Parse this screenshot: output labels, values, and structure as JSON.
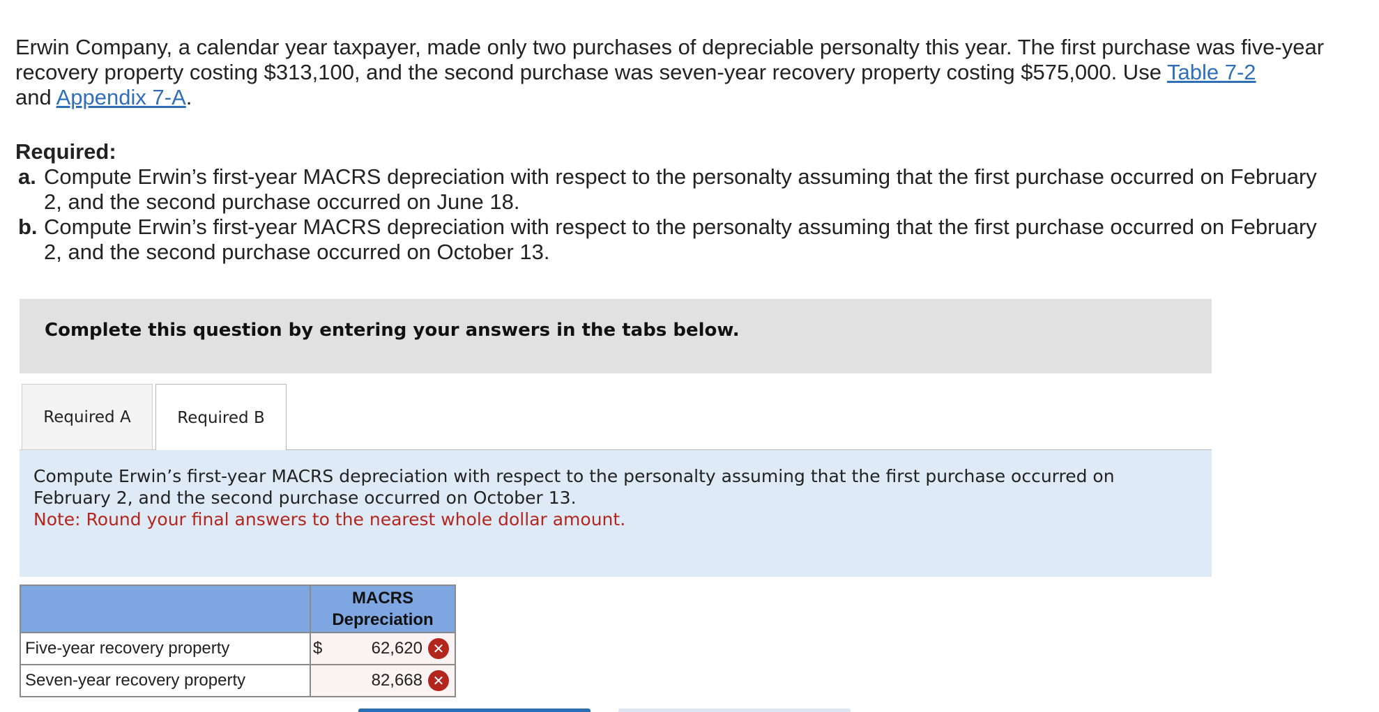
{
  "problem": {
    "intro_text": "Erwin Company, a calendar year taxpayer, made only two purchases of depreciable personalty this year. The first purchase was five-year recovery property costing $313,100, and the second purchase was seven-year recovery property costing $575,000. Use ",
    "link_table": "Table 7-2",
    "joiner": "and ",
    "link_appendix": "Appendix 7-A",
    "end_period": ".",
    "required_heading": "Required:",
    "items": [
      {
        "letter": "a.",
        "text": "Compute Erwin’s first-year MACRS depreciation with respect to the personalty assuming that the first purchase occurred on February 2, and the second purchase occurred on June 18."
      },
      {
        "letter": "b.",
        "text": "Compute Erwin’s first-year MACRS depreciation with respect to the personalty assuming that the first purchase occurred on February 2, and the second purchase occurred on October 13."
      }
    ]
  },
  "banner": {
    "text": "Complete this question by entering your answers in the tabs below."
  },
  "tabs": [
    {
      "label": "Required A",
      "active": false
    },
    {
      "label": "Required B",
      "active": true
    }
  ],
  "instructions": {
    "text": "Compute Erwin’s first-year MACRS depreciation with respect to the personalty assuming that the first purchase occurred on February 2, and the second purchase occurred on October 13.",
    "note": "Note: Round your final answers to the nearest whole dollar amount."
  },
  "answer_table": {
    "column_header": "MACRS Depreciation",
    "rows": [
      {
        "label": "Five-year recovery property",
        "currency": "$",
        "value": "62,620",
        "status": "incorrect"
      },
      {
        "label": "Seven-year recovery property",
        "currency": "",
        "value": "82,668",
        "status": "incorrect"
      }
    ],
    "incorrect_icon": "x-circle-icon",
    "incorrect_symbol": "✕"
  },
  "colors": {
    "link": "#2f6fb8",
    "note": "#b3261e",
    "table_header": "#7ea6e0",
    "instructions_bg": "#deebf7",
    "banner_bg": "#e1e1e1",
    "incorrect": "#b3261e",
    "nav_primary": "#2a6db5"
  }
}
